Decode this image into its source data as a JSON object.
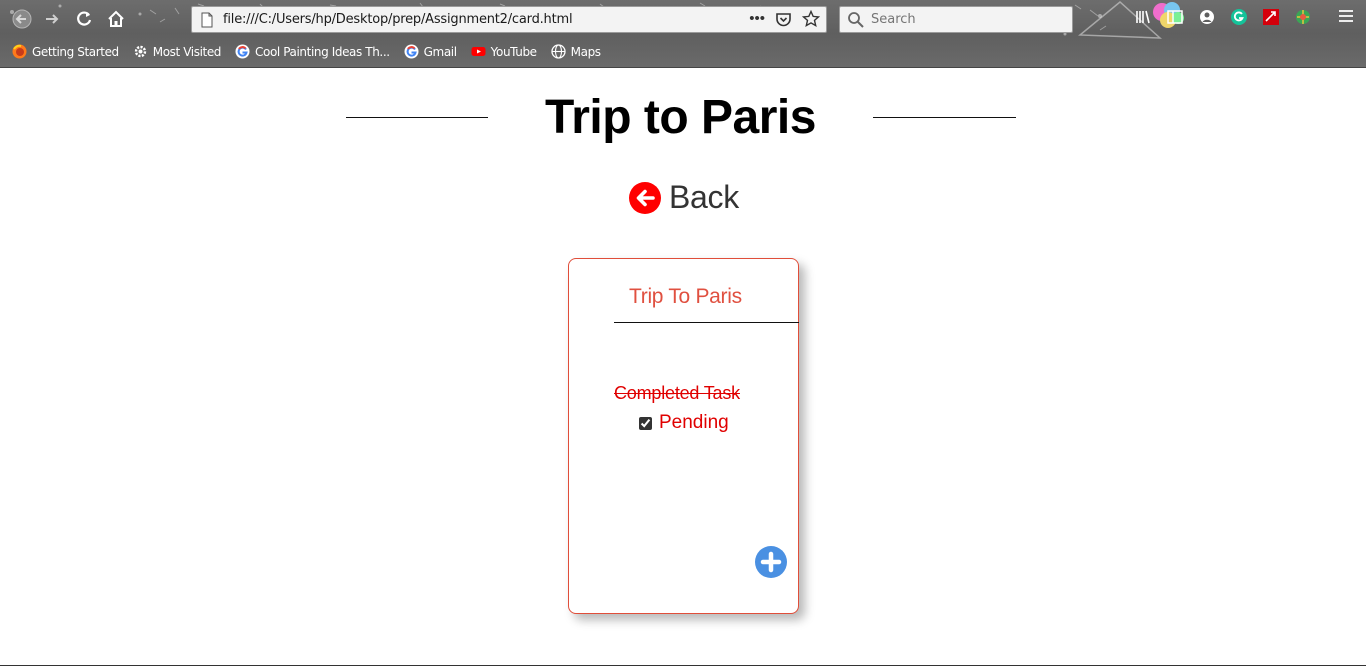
{
  "browser": {
    "url": "file:///C:/Users/hp/Desktop/prep/Assignment2/card.html",
    "search_placeholder": "Search",
    "url_actions": [
      "•••"
    ],
    "bookmarks": [
      {
        "label": "Getting Started",
        "icon": "firefox-icon"
      },
      {
        "label": "Most Visited",
        "icon": "gear-icon"
      },
      {
        "label": "Cool Painting Ideas Th...",
        "icon": "google-icon"
      },
      {
        "label": "Gmail",
        "icon": "google-icon"
      },
      {
        "label": "YouTube",
        "icon": "youtube-icon"
      },
      {
        "label": "Maps",
        "icon": "globe-icon"
      }
    ]
  },
  "page": {
    "title": "Trip to Paris",
    "back_label": "Back",
    "accent_color": "#e00000"
  },
  "card": {
    "title": "Trip To Paris",
    "completed_task": "Completed Task",
    "pending_task": "Pending",
    "pending_checked": true,
    "border_color": "#e04e3a",
    "add_button_color": "#4a90e2"
  }
}
